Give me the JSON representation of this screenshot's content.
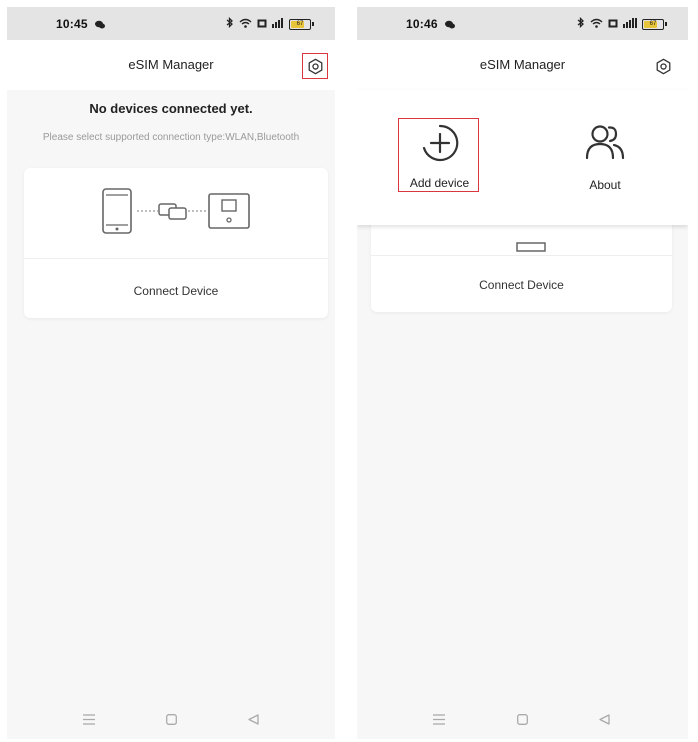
{
  "left": {
    "status": {
      "time": "10:45",
      "battery_level": "67"
    },
    "app_bar": {
      "title": "eSIM Manager"
    },
    "empty_state": {
      "title": "No devices connected yet.",
      "hint": "Please select supported connection type:WLAN,Bluetooth"
    },
    "card": {
      "action_label": "Connect Device"
    }
  },
  "right": {
    "status": {
      "time": "10:46",
      "battery_level": "67"
    },
    "app_bar": {
      "title": "eSIM Manager"
    },
    "menu": {
      "items": [
        {
          "label": "Add device",
          "icon": "add-circle-icon"
        },
        {
          "label": "About",
          "icon": "people-icon"
        }
      ]
    },
    "card": {
      "action_label": "Connect Device"
    }
  },
  "colors": {
    "highlight": "#d9363e",
    "status_bar": "#e4e4e4",
    "background": "#f7f7f7"
  }
}
